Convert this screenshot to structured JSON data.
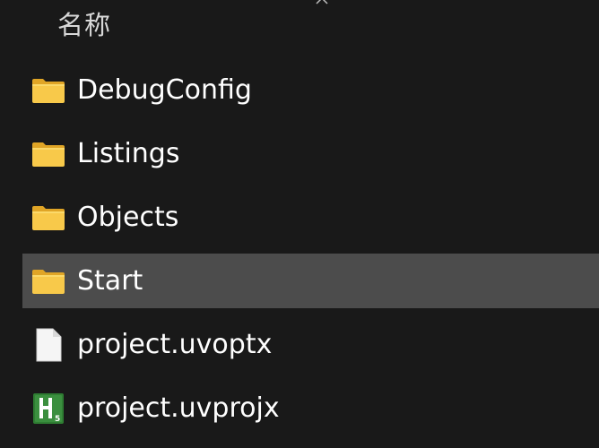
{
  "header": {
    "column_name": "名称",
    "sort_icon": "chevron-up-icon"
  },
  "files": [
    {
      "name": "DebugConfig",
      "type": "folder",
      "icon": "folder-icon",
      "selected": false
    },
    {
      "name": "Listings",
      "type": "folder",
      "icon": "folder-icon",
      "selected": false
    },
    {
      "name": "Objects",
      "type": "folder",
      "icon": "folder-icon",
      "selected": false
    },
    {
      "name": "Start",
      "type": "folder",
      "icon": "folder-icon",
      "selected": true
    },
    {
      "name": "project.uvoptx",
      "type": "file",
      "icon": "document-icon",
      "selected": false
    },
    {
      "name": "project.uvprojx",
      "type": "keil-project",
      "icon": "keil-uvision-icon",
      "selected": false
    }
  ],
  "colors": {
    "background": "#191919",
    "selected_row": "#4c4c4c",
    "folder_yellow": "#f7c948",
    "keil_green": "#2e7d32"
  }
}
